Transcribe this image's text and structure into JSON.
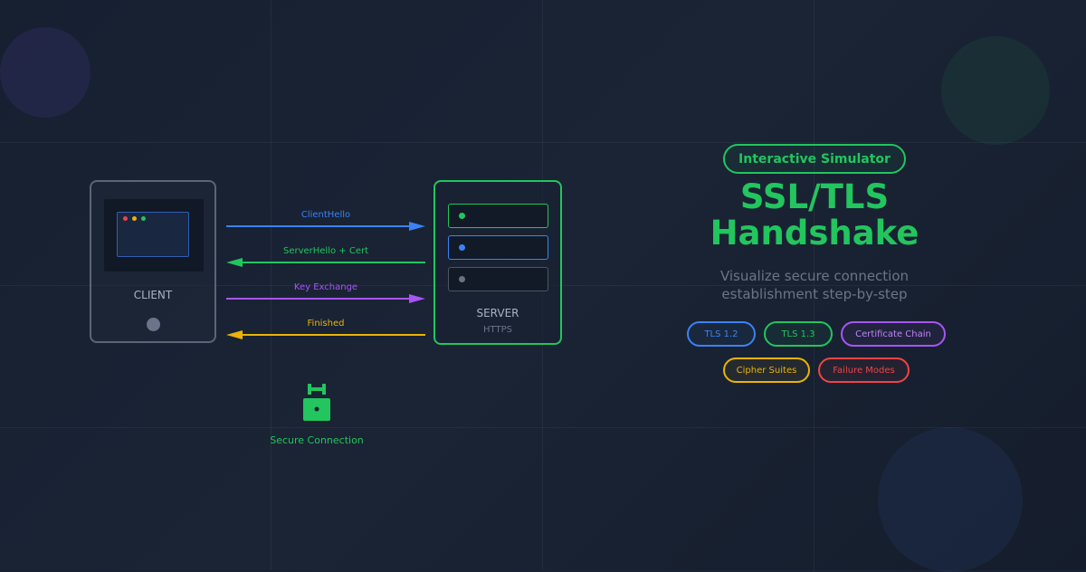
{
  "client": {
    "label": "CLIENT"
  },
  "server": {
    "label": "SERVER",
    "sublabel": "HTTPS"
  },
  "messages": [
    {
      "label": "ClientHello",
      "direction": "client-to-server",
      "color": "#3b82f6"
    },
    {
      "label": "ServerHello + Cert",
      "direction": "server-to-client",
      "color": "#22c55e"
    },
    {
      "label": "Key Exchange",
      "direction": "client-to-server",
      "color": "#a855f7"
    },
    {
      "label": "Finished",
      "direction": "server-to-client",
      "color": "#eab308"
    }
  ],
  "lock": {
    "label": "Secure Connection",
    "icon": "lock-icon",
    "color": "#22c55e"
  },
  "badge": {
    "label": "Interactive Simulator"
  },
  "title": {
    "line1": "SSL/TLS",
    "line2": "Handshake"
  },
  "subtitle": {
    "line1": "Visualize secure connection",
    "line2": "establishment step-by-step"
  },
  "tags": [
    {
      "label": "TLS 1.2",
      "color": "#3b82f6"
    },
    {
      "label": "TLS 1.3",
      "color": "#22c55e"
    },
    {
      "label": "Certificate Chain",
      "color": "#a855f7"
    },
    {
      "label": "Cipher Suites",
      "color": "#eab308"
    },
    {
      "label": "Failure Modes",
      "color": "#ef4444"
    }
  ],
  "colors": {
    "accent": "#22c55e",
    "background": "#182234"
  }
}
